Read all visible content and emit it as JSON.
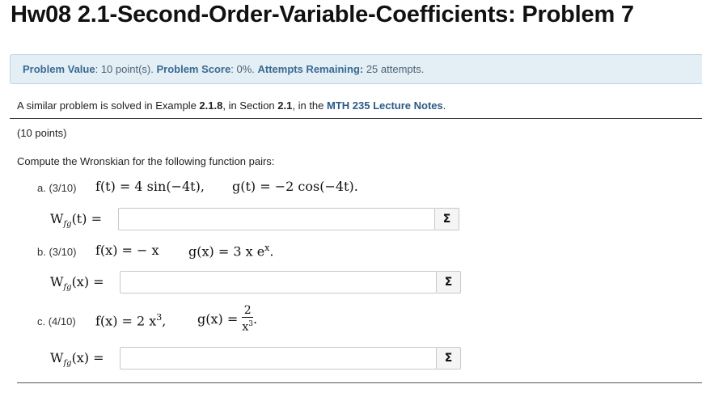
{
  "page": {
    "title": "Hw08 2.1-Second-Order-Variable-Coefficients: Problem 7"
  },
  "info": {
    "value_label": "Problem Value",
    "value_text": ": 10 point(s). ",
    "score_label": "Problem Score",
    "score_text": ": 0%. ",
    "attempts_label": "Attempts Remaining:",
    "attempts_text": " 25 attempts."
  },
  "note": {
    "prefix": "A similar problem is solved in Example ",
    "example": "2.1.8",
    "mid1": ", in Section ",
    "section": "2.1",
    "mid2": ", in the ",
    "notes": "MTH 235 Lecture Notes",
    "suffix": "."
  },
  "points": "(10 points)",
  "prompt": "Compute the Wronskian for the following function pairs:",
  "parts": [
    {
      "label": "a. (3/10)",
      "f": "f(t) = 4 sin(−4t),",
      "g": "g(t) = −2 cos(−4t).",
      "answer_label": "W",
      "answer_sub": "fg",
      "answer_arg": "(t) =",
      "answer_value": ""
    },
    {
      "label": "b. (3/10)",
      "f": "f(x) = − x",
      "g": "g(x) = 3 x e",
      "g_sup": "x",
      "g_end": ".",
      "answer_label": "W",
      "answer_sub": "fg",
      "answer_arg": "(x) =",
      "answer_value": ""
    },
    {
      "label": "c. (4/10)",
      "f": "f(x) = 2 x",
      "f_sup": "3",
      "f_end": ",",
      "g": "g(x) =",
      "g_num": "2",
      "g_den": "x",
      "g_den_sup": "3",
      "g_end": ".",
      "answer_label": "W",
      "answer_sub": "fg",
      "answer_arg": "(x) =",
      "answer_value": ""
    }
  ],
  "equation_button_symbol": "Σ"
}
